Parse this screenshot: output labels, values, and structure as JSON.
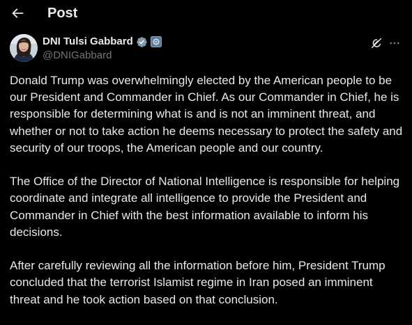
{
  "header": {
    "back_icon": "arrow-left-icon",
    "title": "Post"
  },
  "author": {
    "display_name": "DNI Tulsi Gabbard",
    "handle": "@DNIGabbard",
    "verified_badge": "verified-checkmark-icon",
    "affiliation_badge": "government-affiliation-icon",
    "verified_color": "#829aab"
  },
  "actions": {
    "grok_icon": "grok-icon",
    "more_icon": "more-dots-icon"
  },
  "post": {
    "paragraphs": [
      "Donald Trump was overwhelmingly elected by the American people to be our President and Commander in Chief. As our Commander in Chief, he is responsible for determining what is and is not an imminent threat, and whether or not to take action he deems necessary to protect the safety and security of our troops, the American people and our country.",
      "The Office of the Director of National Intelligence is responsible for helping coordinate and integrate all intelligence to provide the President and Commander in Chief with the best information available to inform his decisions.",
      "After carefully reviewing all the information before him, President Trump concluded that the terrorist Islamist regime in Iran posed an imminent threat and he took action based on that conclusion."
    ]
  },
  "colors": {
    "background": "#000000",
    "text_primary": "#e7e9ea",
    "text_secondary": "#71767b"
  }
}
